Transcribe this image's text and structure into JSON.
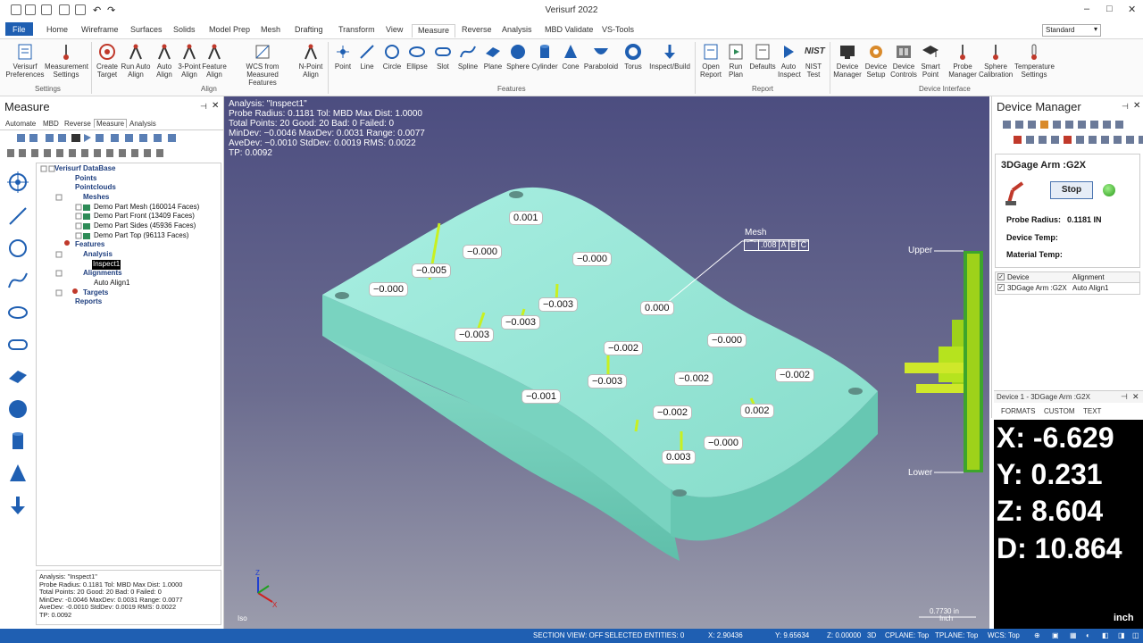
{
  "app": {
    "title": "Verisurf 2022",
    "window_controls": [
      "–",
      "□",
      "✕"
    ]
  },
  "menu": {
    "items": [
      "File",
      "Home",
      "Wireframe",
      "Surfaces",
      "Solids",
      "Model Prep",
      "Mesh",
      "Drafting",
      "Transform",
      "View",
      "Measure",
      "Reverse",
      "Analysis",
      "MBD Validate",
      "VS-Tools"
    ],
    "active": "Measure",
    "style_select": "Standard"
  },
  "ribbon": {
    "groups": [
      "Settings",
      "Align",
      "Features",
      "Report",
      "Device Interface"
    ],
    "buttons": [
      "Verisurf Preferences",
      "Measurement Settings",
      "Create Target",
      "Run Auto Align",
      "Auto Align",
      "3-Point Align",
      "Feature Align",
      "WCS from Measured Features",
      "N-Point Align",
      "Point",
      "Line",
      "Circle",
      "Ellipse",
      "Slot",
      "Spline",
      "Plane",
      "Sphere",
      "Cylinder",
      "Cone",
      "Paraboloid",
      "Torus",
      "Inspect/Build",
      "Open Report",
      "Run Plan",
      "Defaults",
      "Auto Inspect",
      "NIST Test",
      "Device Manager",
      "Device Setup",
      "Device Controls",
      "Smart Point",
      "Probe Manager",
      "Sphere Calibration",
      "Temperature Settings"
    ]
  },
  "left": {
    "title": "Measure",
    "tabs": [
      "Automate",
      "MBD",
      "Reverse",
      "Measure",
      "Analysis"
    ],
    "tree": [
      "Verisurf DataBase",
      "Points",
      "Pointclouds",
      "Meshes",
      "Demo Part Mesh (160014 Faces)",
      "Demo Part Front (13409 Faces)",
      "Demo Part Sides (45936 Faces)",
      "Demo Part Top (96113 Faces)",
      "Features",
      "Analysis",
      "Inspect1",
      "Alignments",
      "Auto Align1",
      "Targets",
      "Reports"
    ],
    "summary": [
      "Analysis: \"Inspect1\"",
      "Probe Radius: 0.1181 Tol: MBD Max Dist: 1.0000",
      "Total Points: 20 Good: 20 Bad: 0 Failed: 0",
      "MinDev: -0.0046 MaxDev: 0.0031 Range: 0.0077",
      "AveDev: -0.0010 StdDev: 0.0019 RMS: 0.0022",
      "TP: 0.0092"
    ]
  },
  "viewport": {
    "info": [
      "Analysis: \"Inspect1\"",
      "Probe Radius: 0.1181 Tol: MBD Max Dist: 1.0000",
      "Total Points: 20 Good: 20 Bad: 0 Failed: 0",
      "MinDev: −0.0046 MaxDev: 0.0031 Range: 0.0077",
      "AveDev: −0.0010 StdDev: 0.0019 RMS: 0.0022",
      "TP: 0.0092"
    ],
    "labels": [
      "0.001",
      "−0.000",
      "−0.000",
      "−0.005",
      "−0.000",
      "−0.003",
      "−0.003",
      "−0.003",
      "0.000",
      "−0.002",
      "−0.000",
      "−0.003",
      "−0.002",
      "−0.002",
      "−0.001",
      "−0.002",
      "0.002",
      "−0.000",
      "0.003"
    ],
    "mesh_label": "Mesh",
    "gdt": ".008",
    "datums": [
      "A",
      "B",
      "C"
    ],
    "upper": "Upper",
    "lower": "Lower",
    "scale": "0.7730 in",
    "scale_unit": "Inch",
    "view": "Iso",
    "accent": "#9fe8d8"
  },
  "device": {
    "title": "Device Manager",
    "name": "3DGage Arm :G2X",
    "stop": "Stop",
    "probe_label": "Probe Radius:",
    "probe_value": "0.1181 IN",
    "device_temp": "Device Temp:",
    "material_temp": "Material Temp:",
    "table_headers": [
      "Device",
      "Alignment"
    ],
    "table_row": [
      "3DGage Arm :G2X",
      "Auto Align1"
    ]
  },
  "readout": {
    "title": "Device 1 - 3DGage Arm :G2X",
    "tabs": [
      "FORMATS",
      "CUSTOM",
      "TEXT"
    ],
    "x": "X: -6.629",
    "y": "Y:  0.231",
    "z": "Z:  8.604",
    "d": "D: 10.864",
    "unit": "inch"
  },
  "status": {
    "section": "SECTION VIEW: OFF",
    "selected": "SELECTED ENTITIES: 0",
    "x": "X:  2.90436",
    "y": "Y:  9.65634",
    "z": "Z:  0.00000",
    "mode": "3D",
    "cplane": "CPLANE: Top",
    "tplane": "TPLANE: Top",
    "wcs": "WCS: Top"
  }
}
